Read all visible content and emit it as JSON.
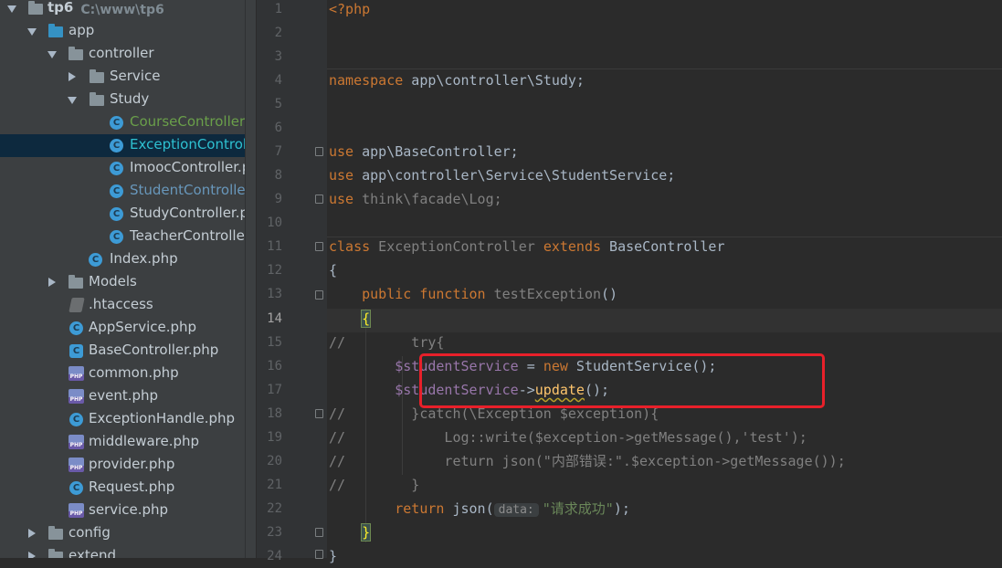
{
  "project": {
    "root": {
      "name": "tp6",
      "path": "C:\\www\\tp6"
    },
    "items": [
      {
        "label": "app"
      },
      {
        "label": "controller"
      },
      {
        "label": "Service"
      },
      {
        "label": "Study"
      },
      {
        "label": "CourseController.php"
      },
      {
        "label": "ExceptionController.php"
      },
      {
        "label": "ImoocController.php"
      },
      {
        "label": "StudentController.php"
      },
      {
        "label": "StudyController.php"
      },
      {
        "label": "TeacherController.php"
      },
      {
        "label": "Index.php"
      },
      {
        "label": "Models"
      },
      {
        "label": ".htaccess"
      },
      {
        "label": "AppService.php"
      },
      {
        "label": "BaseController.php"
      },
      {
        "label": "common.php"
      },
      {
        "label": "event.php"
      },
      {
        "label": "ExceptionHandle.php"
      },
      {
        "label": "middleware.php"
      },
      {
        "label": "provider.php"
      },
      {
        "label": "Request.php"
      },
      {
        "label": "service.php"
      },
      {
        "label": "config"
      },
      {
        "label": "extend"
      }
    ],
    "php_icon_text": "PHP",
    "class_icon_text": "C"
  },
  "editor": {
    "current_line": 14,
    "line_numbers": [
      "1",
      "2",
      "3",
      "4",
      "5",
      "6",
      "7",
      "8",
      "9",
      "10",
      "11",
      "12",
      "13",
      "14",
      "15",
      "16",
      "17",
      "18",
      "19",
      "20",
      "21",
      "22",
      "23",
      "24"
    ],
    "code": {
      "l1": "<?php",
      "l4_kw": "namespace",
      "l4_rest": " app\\controller\\Study;",
      "l7_kw": "use",
      "l7_rest": " app\\BaseController;",
      "l8_kw": "use",
      "l8_rest": " app\\controller\\Service\\StudentService;",
      "l9_kw": "use",
      "l9_rest": " think\\facade\\Log;",
      "l11_kw1": "class",
      "l11_name": " ExceptionController ",
      "l11_kw2": "extends",
      "l11_base": " BaseController",
      "l12": "{",
      "l13_indent": "    ",
      "l13_kw1": "public",
      "l13_kw2": " function",
      "l13_fn": " testException",
      "l13_paren": "()",
      "l14_indent": "    ",
      "l14_brace": "{",
      "l15": "//        try{",
      "l16_indent": "        ",
      "l16_var": "$studentService",
      "l16_op": " = ",
      "l16_kw": "new",
      "l16_rest": " StudentService();",
      "l17_indent": "        ",
      "l17_var": "$studentService",
      "l17_arrow": "->",
      "l17_fn": "update",
      "l17_rest": "();",
      "l18": "//        }catch(\\Exception $exception){",
      "l19": "//            Log::write($exception->getMessage(),'test');",
      "l20": "//            return json(\"内部错误:\".$exception->getMessage());",
      "l21": "//        }",
      "l22_indent": "        ",
      "l22_kw": "return",
      "l22_fn": " json(",
      "l22_hint": "data:",
      "l22_str": "\"请求成功\"",
      "l22_end": ");",
      "l23_indent": "    ",
      "l23_brace": "}",
      "l24": "}"
    }
  },
  "colors": {
    "highlight_box": "#e8202a",
    "keyword": "#cc7832",
    "variable": "#9876aa",
    "string": "#6a8759",
    "function": "#ffc66d"
  }
}
